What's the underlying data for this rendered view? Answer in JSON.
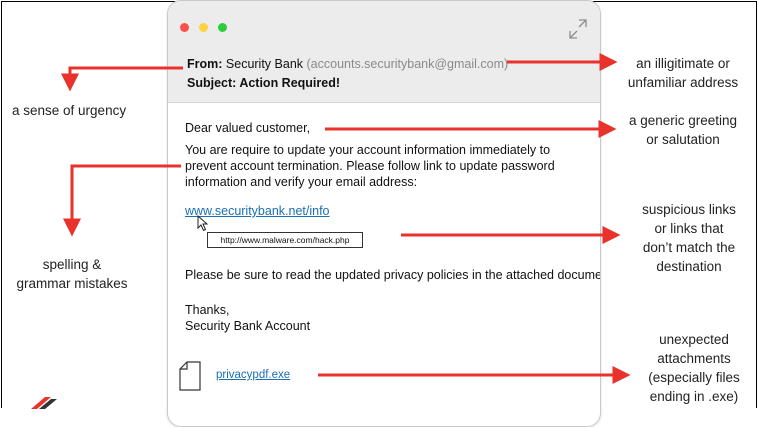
{
  "email": {
    "from_label": "From:",
    "from_name": "Security Bank",
    "from_address": "(accounts.securitybank@gmail.com)",
    "subject": "Subject: Action Required!",
    "greeting": "Dear valued customer,",
    "body_lines": [
      "You are require to update your account information immediately to",
      "prevent account termination. Please follow link to update password",
      "information and verify your email address:"
    ],
    "link_text": "www.securitybank.net/info",
    "link_tooltip": "http://www.malware.com/hack.php",
    "privacy_line": "Please be sure to read the updated privacy policies in the attached document.",
    "signoff": "Thanks,",
    "signature": "Security Bank Account",
    "attachment": "privacypdf.exe"
  },
  "annotations": {
    "address": [
      "an illigitimate or",
      "unfamiliar address"
    ],
    "urgency": [
      "a sense of urgency"
    ],
    "greeting": [
      "a generic greeting",
      "or salutation"
    ],
    "spelling": [
      "spelling &",
      "grammar mistakes"
    ],
    "links": [
      "suspicious links",
      "or links that",
      "don’t match the",
      "destination"
    ],
    "attachments": [
      "unexpected",
      "attachments",
      "(especially files",
      "ending in .exe)"
    ]
  },
  "icons": {
    "window_controls": [
      "close-dot",
      "minimize-dot",
      "zoom-dot"
    ],
    "expand": "expand-icon",
    "cursor": "cursor-icon",
    "file": "file-icon",
    "logo": "logo-icon"
  },
  "colors": {
    "arrow": "#e8322b",
    "link": "#1a6fb5",
    "header_bg": "#ececec",
    "dot_red": "#ff4f4a",
    "dot_yellow": "#ffd33f",
    "dot_green": "#2ccd3f"
  }
}
